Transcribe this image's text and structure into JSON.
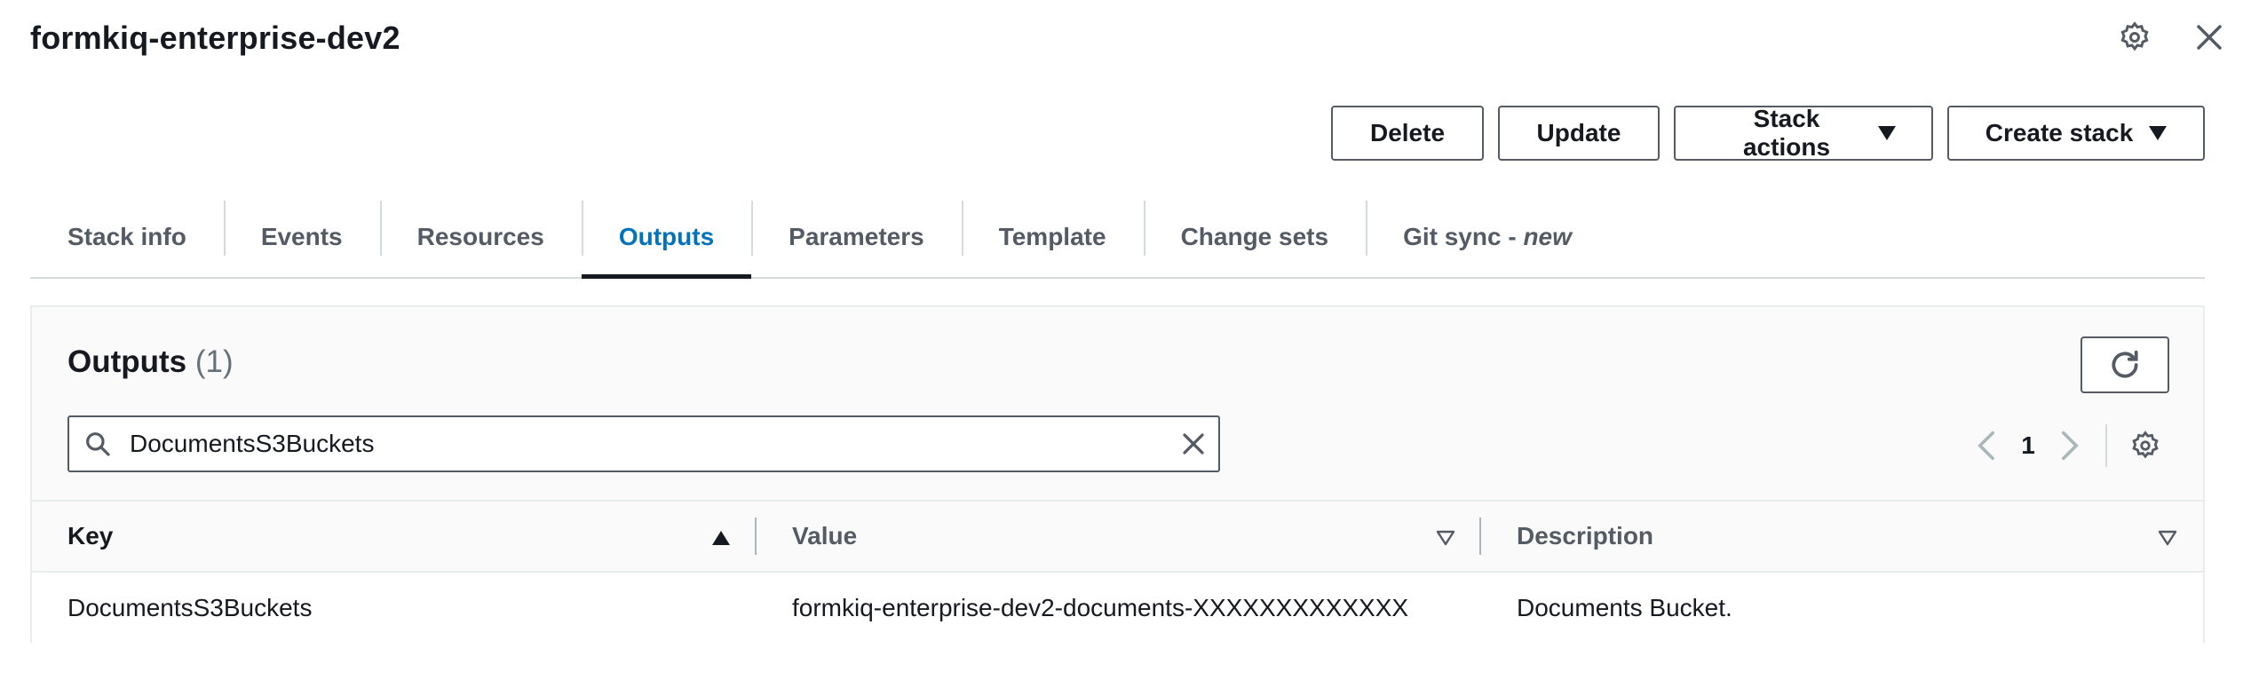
{
  "header": {
    "title": "formkiq-enterprise-dev2"
  },
  "actions": {
    "delete": "Delete",
    "update": "Update",
    "stack_actions": "Stack actions",
    "create_stack": "Create stack"
  },
  "tabs": [
    {
      "label": "Stack info"
    },
    {
      "label": "Events"
    },
    {
      "label": "Resources"
    },
    {
      "label": "Outputs",
      "active": true
    },
    {
      "label": "Parameters"
    },
    {
      "label": "Template"
    },
    {
      "label": "Change sets"
    },
    {
      "label": "Git sync - ",
      "suffix": "new"
    }
  ],
  "outputs": {
    "title": "Outputs",
    "count": "(1)",
    "search": {
      "value": "DocumentsS3Buckets",
      "placeholder": ""
    },
    "pagination": {
      "current_page": "1"
    },
    "columns": [
      "Key",
      "Value",
      "Description"
    ],
    "rows": [
      {
        "key": "DocumentsS3Buckets",
        "value": "formkiq-enterprise-dev2-documents-XXXXXXXXXXXXX",
        "description": "Documents Bucket."
      }
    ]
  },
  "icons": {
    "settings": "gear-icon",
    "close": "close-icon",
    "refresh": "refresh-icon",
    "search": "search-icon",
    "clear": "clear-icon",
    "prev": "chevron-left-icon",
    "next": "chevron-right-icon",
    "sort_asc": "sort-ascending-icon",
    "sort_none": "sort-icon"
  },
  "colors": {
    "active_tab": "#0073bb",
    "text": "#16191f",
    "muted": "#545b64",
    "border": "#eaeded"
  }
}
